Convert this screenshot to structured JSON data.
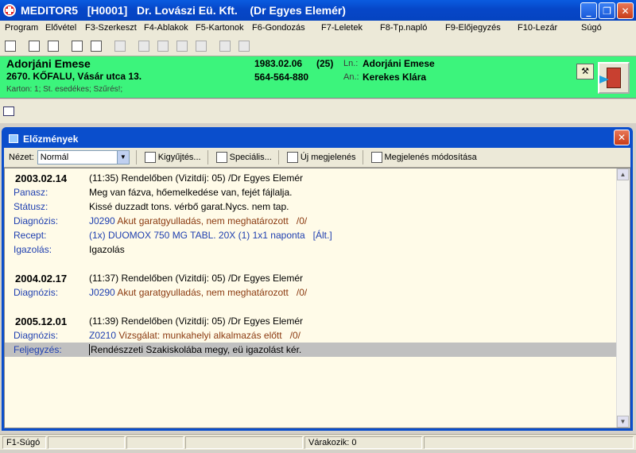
{
  "window": {
    "title": "MEDITOR5   [H0001]   Dr. Lovászi Eü. Kft.    (Dr Egyes Elemér)"
  },
  "menu": [
    "Program",
    "Elővétel",
    "F3-Szerkeszt",
    "F4-Ablakok",
    "F5-Kartonok",
    "F6-Gondozás",
    "F7-Leletek",
    "F8-Tp.napló",
    "F9-Előjegyzés",
    "F10-Lezár",
    "Súgó"
  ],
  "patient": {
    "name": "Adorjáni Emese",
    "address": "2670. KŐFALU, Vásár utca 13.",
    "birth": "1983.02.06",
    "age": "(25)",
    "phone": "564-564-880",
    "ln_label": "Ln.:",
    "ln_value": "Adorjáni Emese",
    "an_label": "An.:",
    "an_value": "Kerekes Klára",
    "info": "Karton: 1; St. esedékes; Szűrés!;"
  },
  "child": {
    "title": "Előzmények",
    "view_label": "Nézet:",
    "view_value": "Normál",
    "buttons": {
      "collect": "Kigyűjtés...",
      "special": "Speciális...",
      "new": "Új megjelenés",
      "modify": "Megjelenés módosítása"
    }
  },
  "entries": [
    {
      "date": "2003.02.14",
      "header": "(11:35) Rendelőben (Vizitdíj: 05) /Dr Egyes Elemér",
      "rows": [
        {
          "k": "Panasz:",
          "v": "Meg van fázva, hőemelkedése van, fejét fájlalja."
        },
        {
          "k": "Státusz:",
          "v": "Kissé duzzadt tons. vérbő garat.Nycs. nem tap."
        },
        {
          "k": "Diagnózis:",
          "code": "J0290",
          "v": "Akut garatgyulladás, nem meghatározott",
          "x": "/0/"
        },
        {
          "k": "Recept:",
          "v": "(1x) DUOMOX 750 MG TABL. 20X (1) 1x1 naponta   [Ált.]"
        },
        {
          "k": "Igazolás:",
          "v": "Igazolás"
        }
      ]
    },
    {
      "date": "2004.02.17",
      "header": "(11:37) Rendelőben (Vizitdíj: 05) /Dr Egyes Elemér",
      "rows": [
        {
          "k": "Diagnózis:",
          "code": "J0290",
          "v": "Akut garatgyulladás, nem meghatározott",
          "x": "/0/"
        }
      ]
    },
    {
      "date": "2005.12.01",
      "header": "(11:39) Rendelőben (Vizitdíj: 05) /Dr Egyes Elemér",
      "rows": [
        {
          "k": "Diagnózis:",
          "code": "Z0210",
          "v": "Vizsgálat: munkahelyi alkalmazás előtt",
          "x": "/0/"
        },
        {
          "k": "Feljegyzés:",
          "v": "Rendészzeti Szakiskolába megy, eü igazolást kér."
        }
      ]
    }
  ],
  "status": {
    "help": "F1-Súgó",
    "waiting": "Várakozik: 0"
  }
}
